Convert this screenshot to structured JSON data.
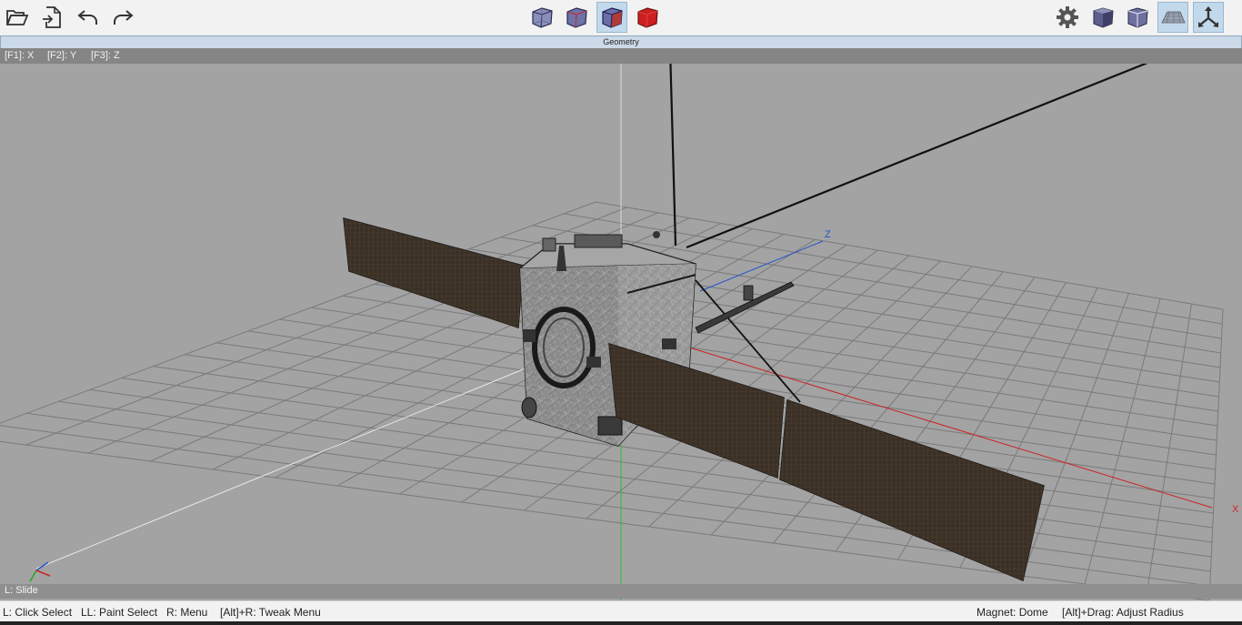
{
  "toolbar": {
    "left_icons": [
      "folder-open-icon",
      "import-file-icon",
      "undo-icon",
      "redo-icon"
    ],
    "view_modes": [
      "wireframe-cube-icon",
      "xray-cube-icon",
      "shaded-wire-cube-icon",
      "solid-red-cube-icon"
    ],
    "active_view_mode": 2,
    "right_icons": [
      "gear-icon",
      "shaded-cube-icon",
      "outline-cube-icon",
      "grid-floor-icon",
      "axes-icon"
    ],
    "active_right": [
      3,
      4
    ]
  },
  "panel": {
    "title": "Geometry"
  },
  "axis_hints": [
    "[F1]: X",
    "[F2]: Y",
    "[F3]: Z"
  ],
  "viewport": {
    "axis_labels": {
      "x": "X",
      "z": "Z"
    },
    "colors": {
      "background": "#a3a3a3",
      "grid": "#7a7a7a",
      "x_axis": "#cc2222",
      "z_axis": "#2255cc",
      "y_axis": "#22aa22"
    }
  },
  "mode_hint": "L: Slide",
  "status": {
    "click_select": "L: Click Select",
    "paint_select": "LL: Paint Select",
    "menu": "R: Menu",
    "tweak_menu": "[Alt]+R: Tweak Menu",
    "magnet": "Magnet: Dome",
    "adjust_radius": "[Alt]+Drag: Adjust Radius"
  }
}
